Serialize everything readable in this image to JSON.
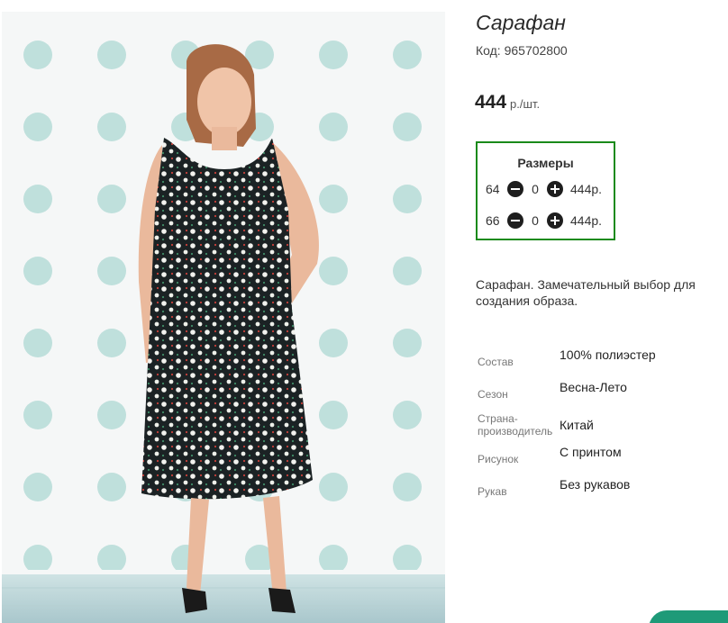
{
  "product": {
    "title": "Сарафан",
    "code": "Код: 965702800",
    "price": "444",
    "price_unit": "р./шт.",
    "image_alt": "product-photo-sundress"
  },
  "sizes": {
    "title": "Размеры",
    "rows": [
      {
        "size": "64",
        "qty": "0",
        "price": "444р."
      },
      {
        "size": "66",
        "qty": "0",
        "price": "444р."
      }
    ]
  },
  "description": "Сарафан. Замечательный выбор для создания образа.",
  "properties": [
    {
      "key": "Состав",
      "value": "100% полиэстер"
    },
    {
      "key": "Сезон",
      "value": "Весна-Лето"
    },
    {
      "key": "Страна-производитель",
      "value": "Китай"
    },
    {
      "key": "Рисунок",
      "value": "С принтом"
    },
    {
      "key": "Рукав",
      "value": "Без рукавов"
    }
  ],
  "colors": {
    "sizes_border": "#1a8a1a",
    "corner_badge": "#1e9a78",
    "wall_dots": "#bfe0dc"
  }
}
